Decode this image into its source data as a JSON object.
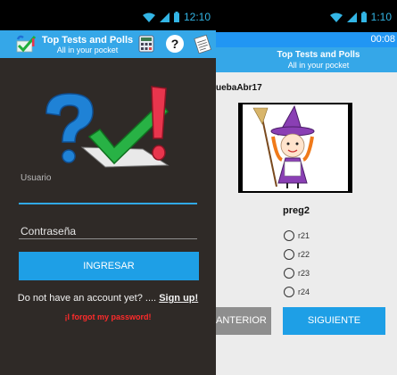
{
  "left_screen": {
    "status_bar": {
      "time": "12:10"
    },
    "app_bar": {
      "title": "Top Tests and Polls",
      "subtitle": "All in your pocket"
    },
    "login": {
      "username_label": "Usuario",
      "password_label": "Contraseña",
      "submit_label": "INGRESAR",
      "signup_prompt": "Do not have an account yet? .... ",
      "signup_link": "Sign up!",
      "forgot_link": "¡I forgot my password!"
    }
  },
  "right_screen": {
    "status_bar": {
      "time": "1:10"
    },
    "time_strip": "00:08",
    "app_bar": {
      "title": "Top Tests and Polls",
      "subtitle": "All in your pocket"
    },
    "quiz_name": "uebaAbr17",
    "question": "preg2",
    "options": [
      "r21",
      "r22",
      "r23",
      "r24"
    ],
    "prev_label": "ANTERIOR",
    "next_label": "SIGUIENTE"
  },
  "colors": {
    "accent_blue": "#35a7e8",
    "button_blue": "#1e9fe6",
    "login_background": "#2f2a27",
    "error_red": "#ff2b2b",
    "status_icon": "#33b5e5"
  }
}
